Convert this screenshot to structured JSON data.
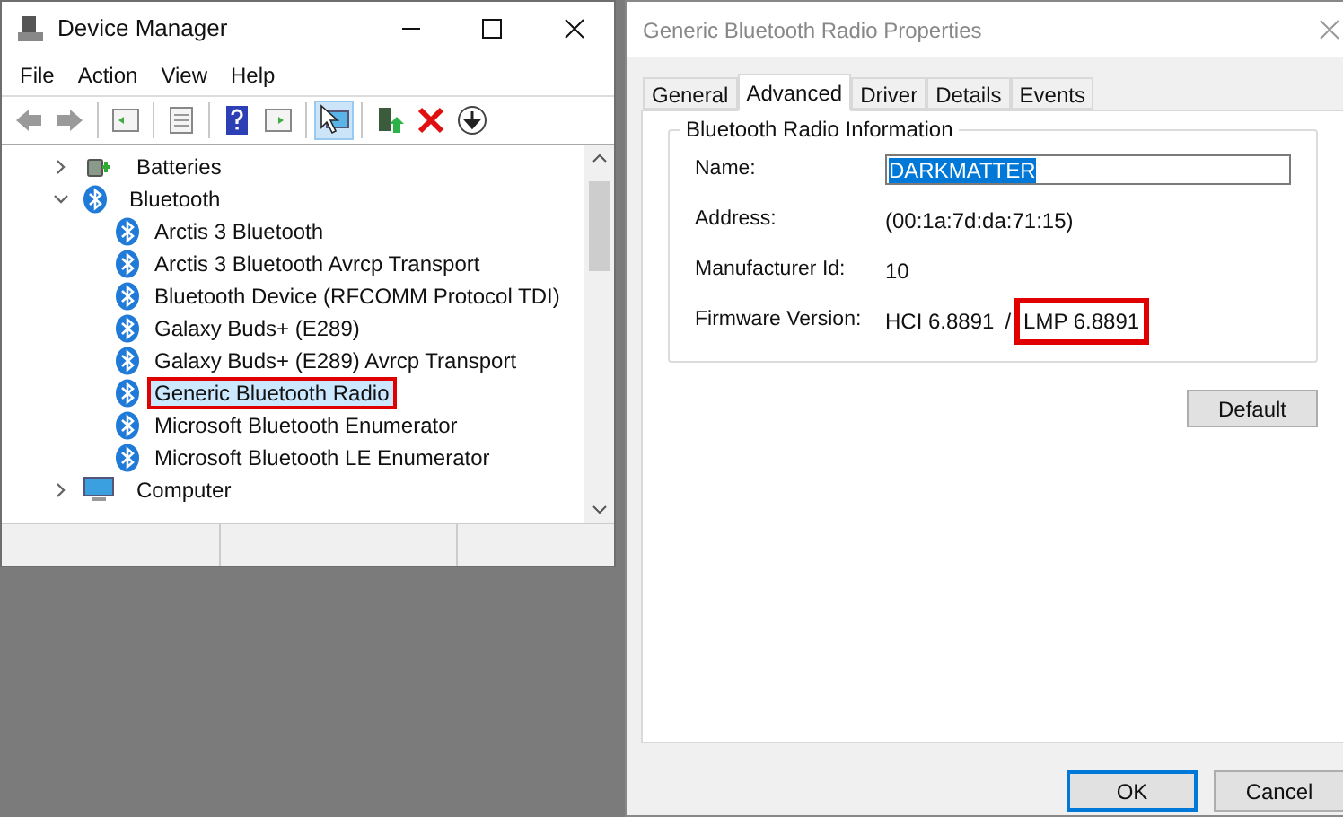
{
  "device_manager": {
    "title": "Device Manager",
    "menu": [
      "File",
      "Action",
      "View",
      "Help"
    ],
    "toolbar_groups": [
      [
        {
          "kind": "back",
          "hovered": false
        },
        {
          "kind": "forward",
          "hovered": false
        }
      ],
      [
        {
          "kind": "tree",
          "hovered": false
        }
      ],
      [
        {
          "kind": "props",
          "hovered": false
        }
      ],
      [
        {
          "kind": "help",
          "hovered": false
        },
        {
          "kind": "pane",
          "hovered": false
        }
      ],
      [
        {
          "kind": "scan",
          "hovered": true
        }
      ],
      [
        {
          "kind": "update",
          "hovered": false
        },
        {
          "kind": "remove",
          "hovered": false
        },
        {
          "kind": "download",
          "hovered": false
        }
      ]
    ],
    "tree": [
      {
        "label": "Batteries",
        "kind": "battery",
        "expanded": false,
        "selected": false
      },
      {
        "label": "Bluetooth",
        "kind": "bluetooth",
        "expanded": true,
        "selected": false,
        "children": [
          {
            "label": "Arctis 3 Bluetooth",
            "kind": "bluetooth",
            "selected": false,
            "highlighted": false
          },
          {
            "label": "Arctis 3 Bluetooth Avrcp Transport",
            "kind": "bluetooth",
            "selected": false,
            "highlighted": false
          },
          {
            "label": "Bluetooth Device (RFCOMM Protocol TDI)",
            "kind": "bluetooth",
            "selected": false,
            "highlighted": false
          },
          {
            "label": "Galaxy Buds+ (E289)",
            "kind": "bluetooth",
            "selected": false,
            "highlighted": false
          },
          {
            "label": "Galaxy Buds+ (E289) Avrcp Transport",
            "kind": "bluetooth",
            "selected": false,
            "highlighted": false
          },
          {
            "label": "Generic Bluetooth Radio",
            "kind": "bluetooth",
            "selected": true,
            "highlighted": true
          },
          {
            "label": "Microsoft Bluetooth Enumerator",
            "kind": "bluetooth",
            "selected": false,
            "highlighted": false
          },
          {
            "label": "Microsoft Bluetooth LE Enumerator",
            "kind": "bluetooth",
            "selected": false,
            "highlighted": false
          }
        ]
      },
      {
        "label": "Computer",
        "kind": "computer",
        "expanded": false,
        "selected": false
      }
    ]
  },
  "properties": {
    "title": "Generic Bluetooth Radio Properties",
    "tabs": [
      {
        "label": "General",
        "selected": false
      },
      {
        "label": "Advanced",
        "selected": true
      },
      {
        "label": "Driver",
        "selected": false
      },
      {
        "label": "Details",
        "selected": false
      },
      {
        "label": "Events",
        "selected": false
      }
    ],
    "group_title": "Bluetooth Radio Information",
    "name_label": "Name:",
    "name_value": "DARKMATTER",
    "fields": [
      {
        "label": "Address:",
        "parts": [
          {
            "text": "(00:1a:7d:da:71:15)",
            "highlighted": false
          }
        ]
      },
      {
        "label": "Manufacturer Id:",
        "parts": [
          {
            "text": "10",
            "highlighted": false
          }
        ]
      },
      {
        "label": "Firmware Version:",
        "parts": [
          {
            "text": "HCI 6.8891",
            "highlighted": false
          },
          {
            "text": "/",
            "highlighted": false
          },
          {
            "text": "LMP 6.8891",
            "highlighted": true
          }
        ]
      }
    ],
    "default_button": "Default",
    "buttons": [
      {
        "label": "OK",
        "default": true
      },
      {
        "label": "Cancel",
        "default": false
      }
    ]
  }
}
